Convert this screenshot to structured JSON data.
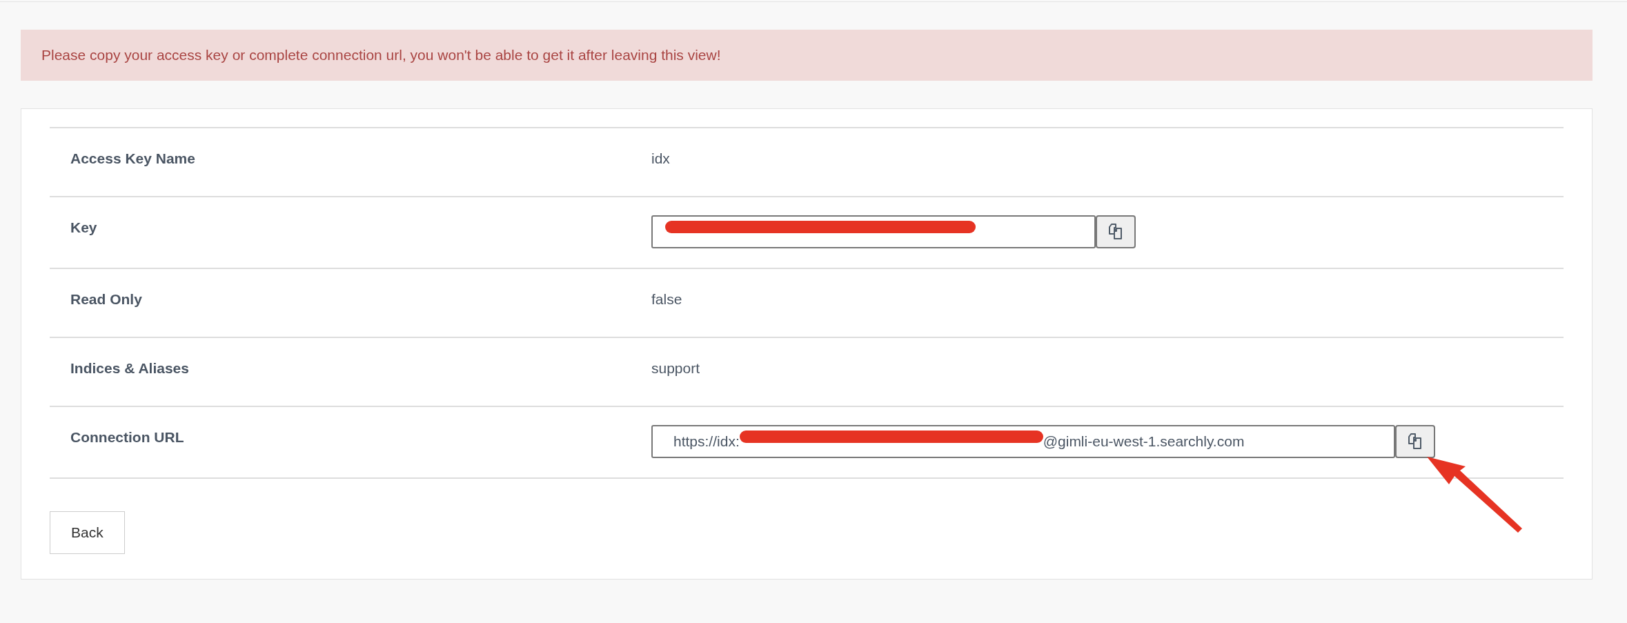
{
  "alert": {
    "text": "Please copy your access key or complete connection url, you won't be able to get it after leaving this view!"
  },
  "details": [
    {
      "kind": "text",
      "label": "Access Key Name",
      "value": "idx"
    },
    {
      "kind": "copy-field",
      "label": "Key",
      "redacted": true
    },
    {
      "kind": "text",
      "label": "Read Only",
      "value": "false"
    },
    {
      "kind": "text",
      "label": "Indices & Aliases",
      "value": "support"
    },
    {
      "kind": "copy-field",
      "label": "Connection URL",
      "redacted": true,
      "value_before": "https://idx:",
      "value_after": "@gimli-eu-west-1.searchly.com",
      "pointed_at": true
    }
  ],
  "buttons": [
    {
      "label": "Back"
    }
  ]
}
